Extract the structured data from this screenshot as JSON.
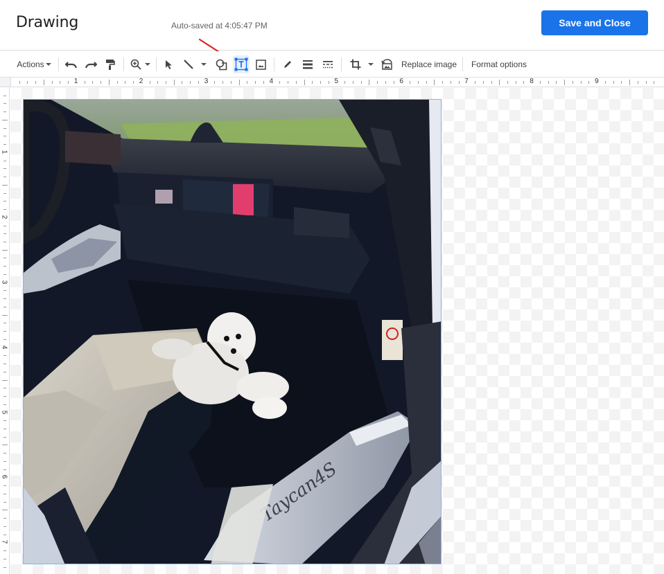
{
  "header": {
    "title": "Drawing",
    "autosave_status": "Auto-saved at 4:05:47 PM",
    "save_close_label": "Save and Close"
  },
  "toolbar": {
    "actions_label": "Actions",
    "replace_image_label": "Replace image",
    "format_options_label": "Format options",
    "active_tool": "text-box",
    "icons": [
      "undo",
      "redo",
      "paint-format",
      "zoom",
      "select",
      "line",
      "shape",
      "text-box",
      "image",
      "border-color",
      "border-weight",
      "border-dash",
      "crop",
      "reset-image"
    ]
  },
  "ruler": {
    "horizontal_labels": [
      "1",
      "2",
      "3",
      "4",
      "5",
      "6",
      "7",
      "8",
      "9"
    ],
    "vertical_labels": [
      "1",
      "2",
      "3",
      "4",
      "5",
      "6",
      "7"
    ]
  },
  "canvas": {
    "image_description": "Car interior with white dog on floor mat, door sill reading Taycan 4S",
    "sill_text": "Taycan4S",
    "selected": true
  },
  "annotation": {
    "arrow_color": "#e02020",
    "points_to": "text-box"
  },
  "colors": {
    "accent": "#1a73e8",
    "active_tool_bg": "#e8f0fe"
  }
}
